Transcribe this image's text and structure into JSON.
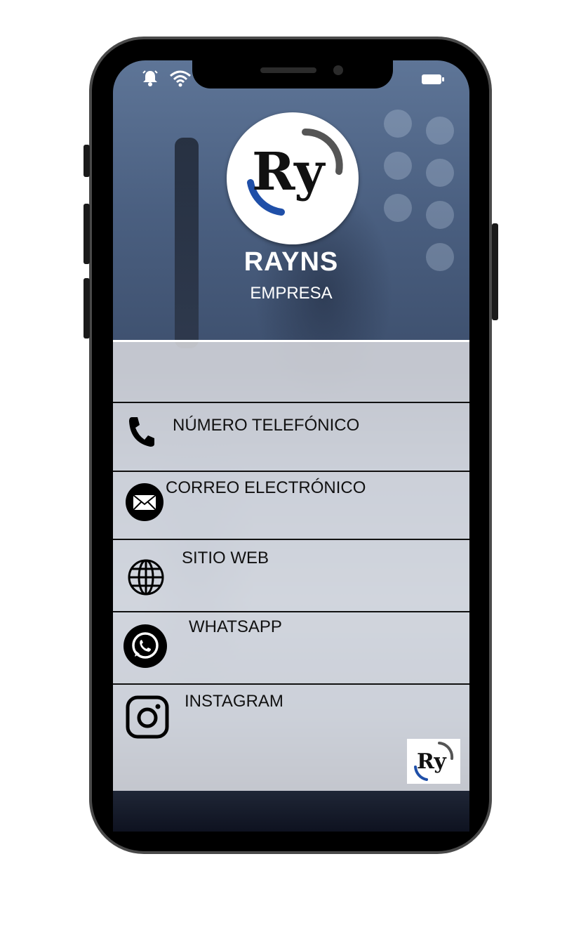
{
  "profile": {
    "logo_letters": "Ry",
    "name": "RAYNS",
    "subtitle": "EMPRESA"
  },
  "contacts": [
    {
      "label": "NÚMERO TELEFÓNICO",
      "icon": "phone-icon"
    },
    {
      "label": "CORREO ELECTRÓNICO",
      "icon": "email-icon"
    },
    {
      "label": "SITIO WEB",
      "icon": "globe-icon"
    },
    {
      "label": "WHATSAPP",
      "icon": "whatsapp-icon"
    },
    {
      "label": "INSTAGRAM",
      "icon": "instagram-icon"
    }
  ],
  "colors": {
    "accent_blue": "#1f4fa8",
    "logo_gray": "#555555"
  }
}
